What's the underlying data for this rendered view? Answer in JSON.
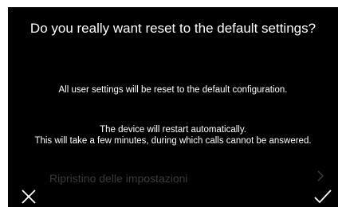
{
  "dialog": {
    "title": "Do you really want reset to the default settings?",
    "message": "All user settings will be reset to the default configuration.",
    "warning_lines": [
      "The device will restart automatically.",
      "This will take a few minutes, during which calls cannot be answered."
    ],
    "cancel_icon": "close-icon",
    "confirm_icon": "checkmark-icon"
  },
  "background_menu": {
    "item_label": "Ripristino delle impostazioni",
    "item_icon": "chevron-right-icon"
  },
  "colors": {
    "background": "#000000",
    "text": "#ffffff",
    "dim_text": "#3a3a3a"
  }
}
